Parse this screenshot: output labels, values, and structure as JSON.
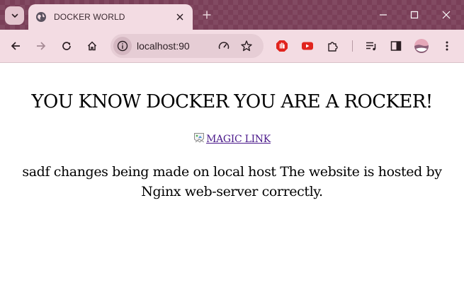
{
  "browser": {
    "tab": {
      "title": "DOCKER WORLD",
      "favicon": "globe-icon"
    },
    "address_bar": {
      "url": "localhost:90"
    },
    "colors": {
      "frame": "#7a3f58",
      "toolbar": "#f3dce3",
      "omnibox": "#e6cdd5"
    }
  },
  "page": {
    "heading": "YOU KNOW DOCKER YOU ARE A ROCKER!",
    "link_text": "MAGIC LINK",
    "paragraph": "sadf changes being made on local host The website is hosted by Nginx web-server correctly.",
    "link_color": "#4b1a8b"
  }
}
